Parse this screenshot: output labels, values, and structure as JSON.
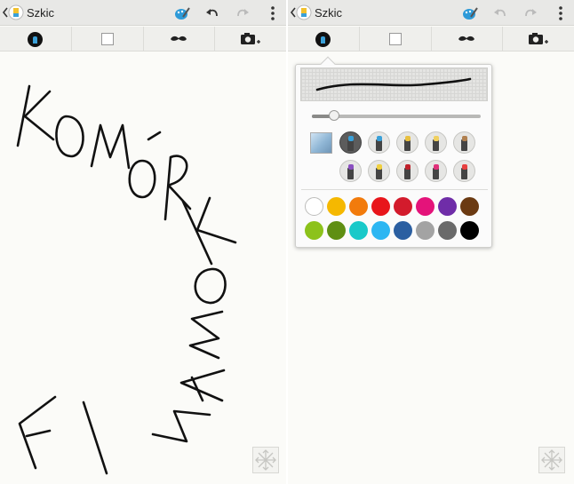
{
  "left_screen": {
    "title": "Szkic",
    "sketch_text": "KOMÓRKOMANIA"
  },
  "right_screen": {
    "title": "Szkic",
    "pen_options": {
      "slider_value": 0.13,
      "pens_row1": [
        {
          "name": "marker-pen",
          "tip_color": "#3aa0d8",
          "selected": true
        },
        {
          "name": "highlighter-pen",
          "tip_color": "#3aa0d8",
          "selected": false
        },
        {
          "name": "pencil",
          "tip_color": "#e8c040",
          "selected": false
        },
        {
          "name": "chalk-pen",
          "tip_color": "#f0d060",
          "selected": false
        },
        {
          "name": "brush-pen",
          "tip_color": "#b08050",
          "selected": false
        }
      ],
      "pens_row2": [
        {
          "name": "spray-pen",
          "tip_color": "#8a4fc0",
          "selected": false
        },
        {
          "name": "sparkle-pen",
          "tip_color": "#f0d040",
          "selected": false
        },
        {
          "name": "heart-pen",
          "tip_color": "#c0202a",
          "selected": false
        },
        {
          "name": "lipstick-pen",
          "tip_color": "#e0307a",
          "selected": false
        },
        {
          "name": "rainbow-pen",
          "tip_color": "#e84040",
          "selected": false
        }
      ],
      "colors": [
        "#ffffff",
        "#f5b800",
        "#f27b0c",
        "#e8151b",
        "#d31b2c",
        "#e4137a",
        "#6f2da8",
        "#6b3a12",
        "#8cc21b",
        "#5f8f13",
        "#19c9c9",
        "#2cb6f2",
        "#2b5fa1",
        "#a3a3a3",
        "#6a6a6a",
        "#000000"
      ]
    }
  }
}
